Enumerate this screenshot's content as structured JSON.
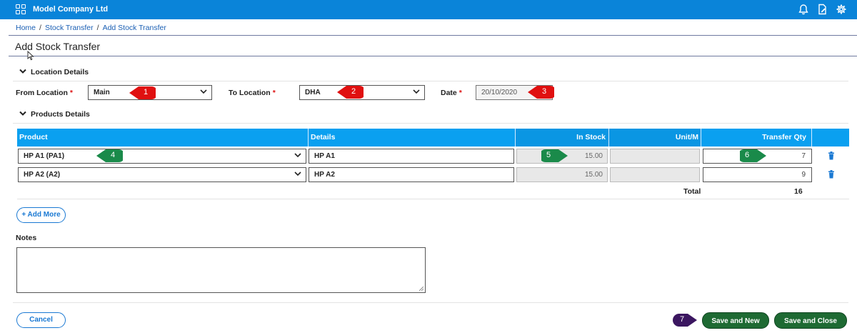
{
  "app": {
    "company": "Model Company Ltd"
  },
  "topbar_icons": [
    "apps-grid-icon",
    "bell-icon",
    "document-pen-icon",
    "gear-icon"
  ],
  "breadcrumb": {
    "home": "Home",
    "section": "Stock Transfer",
    "current": "Add Stock Transfer",
    "separator": "/"
  },
  "page": {
    "title": "Add Stock Transfer"
  },
  "location_section": {
    "title": "Location Details"
  },
  "from_location": {
    "label": "From Location",
    "value": "Main"
  },
  "to_location": {
    "label": "To Location",
    "value": "DHA"
  },
  "date": {
    "label": "Date",
    "value": "20/10/2020"
  },
  "products_section": {
    "title": "Products Details"
  },
  "table": {
    "headers": {
      "product": "Product",
      "details": "Details",
      "in_stock": "In Stock",
      "unit": "Unit/M",
      "transfer_qty": "Transfer Qty"
    },
    "rows": [
      {
        "product": "HP A1 (PA1)",
        "details": "HP A1",
        "in_stock": "15.00",
        "unit": "",
        "qty": "7"
      },
      {
        "product": "HP A2 (A2)",
        "details": "HP A2",
        "in_stock": "15.00",
        "unit": "",
        "qty": "9"
      }
    ],
    "total_label": "Total",
    "total_value": "16"
  },
  "add_more": "+ Add More",
  "notes": {
    "label": "Notes",
    "value": ""
  },
  "buttons": {
    "cancel": "Cancel",
    "save_new": "Save and New",
    "save_close": "Save and Close"
  },
  "markers": [
    "1",
    "2",
    "3",
    "4",
    "5",
    "6",
    "7"
  ],
  "colors": {
    "topbar": "#0a84d9",
    "table_header": "#0aa0f0",
    "marker_red": "#e01010",
    "marker_green": "#1a8a4a",
    "marker_purple": "#3b1660",
    "save_green": "#1e6a33"
  }
}
